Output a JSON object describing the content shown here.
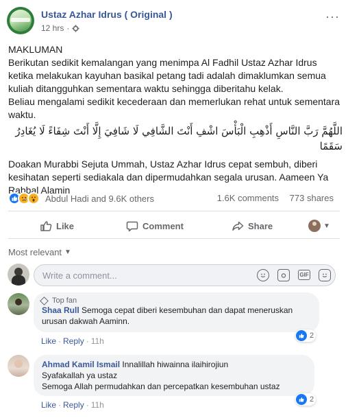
{
  "post": {
    "author": "Ustaz Azhar Idrus ( Original )",
    "time": "12 hrs",
    "time_sep": "·",
    "audience_icon": "gear-icon",
    "more": "···",
    "heading": "MAKLUMAN",
    "para1": "Berikutan sedikit kemalangan yang menimpa Al Fadhil Ustaz Azhar Idrus ketika melakukan kayuhan basikal petang tadi adalah dimaklumkan semua kuliah ditangguhkan sementara waktu sehingga diberitahu kelak.",
    "para2": "Beliau mengalami sedikit kecederaan dan memerlukan rehat untuk sementara waktu.",
    "arabic": "اللَّهُمَّ رَبَّ النَّاسِ أَذْهِبِ الْبَأْسَ اشْفِ أَنْتَ الشَّافِي لَا شَافِيَ إِلَّا أَنْتَ شِفَاءً لَا يُغَادِرُ سَقَمًا",
    "para3": "Doakan Murabbi Sejuta Ummah, Ustaz Azhar Idrus cepat sembuh, diberi kesihatan seperti sediakala dan dipermudahkan segala urusan. Aameen Ya Rabbal Alamin"
  },
  "stats": {
    "reactors": "Abdul Hadi and 9.6K others",
    "comments": "1.6K comments",
    "shares": "773 shares",
    "reaction_icons": [
      "like-icon",
      "sad-icon",
      "wow-icon"
    ]
  },
  "actions": {
    "like": "Like",
    "comment": "Comment",
    "share": "Share"
  },
  "comments_section": {
    "sort_label": "Most relevant",
    "input_placeholder": "Write a comment...",
    "input_icons": [
      "emoji-icon",
      "camera-icon",
      "gif-icon",
      "sticker-icon"
    ],
    "gif_label": "GIF"
  },
  "comments": [
    {
      "badge": "Top fan",
      "name": "Shaa Rull",
      "text": "Semoga cepat diberi kesembuhan dan dapat meneruskan urusan dakwah Aaminn.",
      "like": "Like",
      "reply": "Reply",
      "time": "11h",
      "reactions": "2"
    },
    {
      "name": "Ahmad Kamil Ismail",
      "line1": "Innalillah hiwainna ilaihirojiun",
      "line2": "Syafakallah ya ustaz",
      "line3": "Semoga Allah permudahkan dan percepatkan kesembuhan ustaz",
      "like": "Like",
      "reply": "Reply",
      "time": "11h",
      "reactions": "2"
    }
  ],
  "colors": {
    "link_blue": "#385898",
    "like_blue": "#1877f2",
    "secondary_text": "#65676b",
    "bubble_bg": "#f2f3f5"
  }
}
